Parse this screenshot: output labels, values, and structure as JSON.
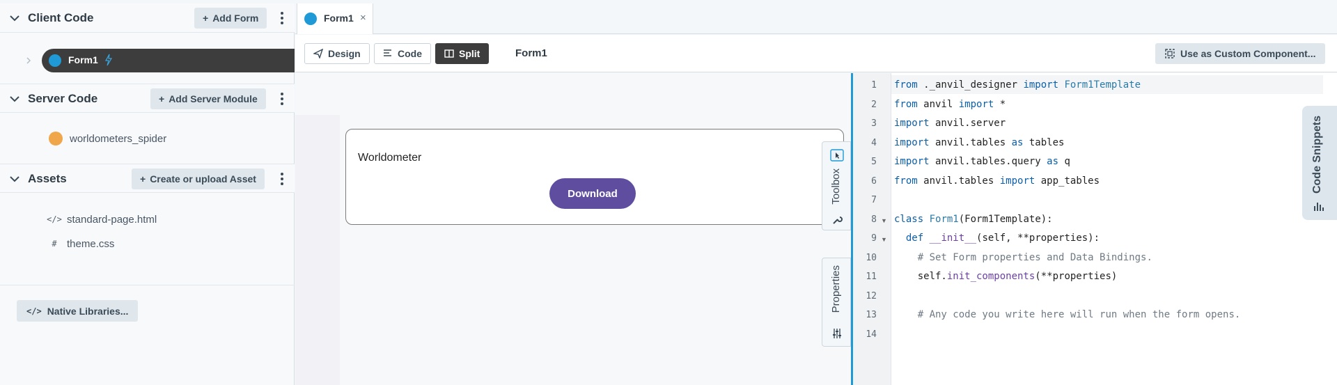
{
  "sidebar": {
    "client_code": {
      "title": "Client Code",
      "add_label": "Add Form"
    },
    "form_item": {
      "label": "Form1"
    },
    "server_code": {
      "title": "Server Code",
      "add_label": "Add Server Module"
    },
    "server_item": {
      "label": "worldometers_spider"
    },
    "assets": {
      "title": "Assets",
      "add_label": "Create or upload Asset"
    },
    "asset_items": [
      {
        "label": "standard-page.html",
        "icon": "</>"
      },
      {
        "label": "theme.css",
        "icon": "#"
      }
    ],
    "native_libraries": "Native Libraries..."
  },
  "tabs": [
    {
      "label": "Form1",
      "close": "×"
    }
  ],
  "toolbar": {
    "design": "Design",
    "code": "Code",
    "split": "Split",
    "form_name": "Form1",
    "custom_component": "Use as Custom Component..."
  },
  "canvas": {
    "label": "Worldometer",
    "button": "Download",
    "toolbox": "Toolbox",
    "properties": "Properties"
  },
  "editor": {
    "line_numbers": [
      "1",
      "2",
      "3",
      "4",
      "5",
      "6",
      "7",
      "8",
      "9",
      "10",
      "11",
      "12",
      "13",
      "14"
    ]
  },
  "code_snippets": "Code Snippets",
  "colors": {
    "accent": "#1f9ad6",
    "button_purple": "#5f4ea0",
    "active_dark": "#3d3d3d"
  }
}
